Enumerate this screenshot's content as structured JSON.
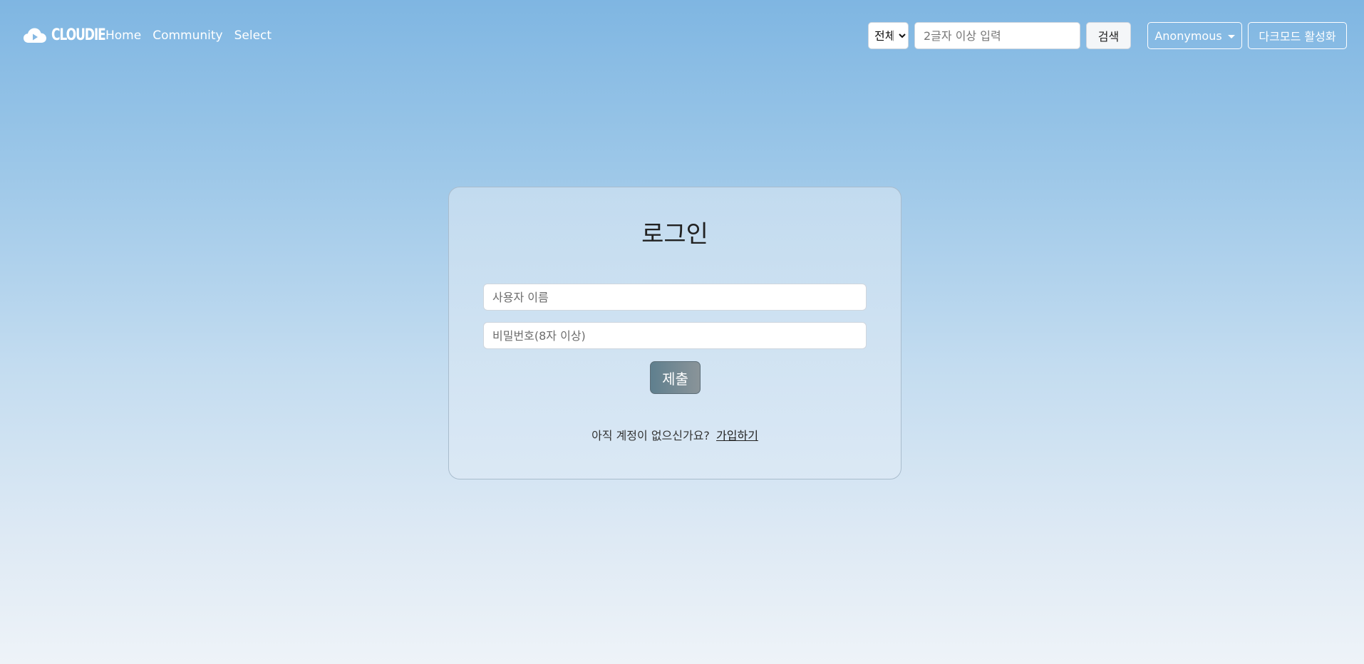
{
  "navbar": {
    "brand": "CLOUDIE",
    "links": [
      "Home",
      "Community",
      "Select"
    ],
    "search": {
      "scope_selected": "전체",
      "placeholder": "2글자 이상 입력",
      "button_label": "검색"
    },
    "user_label": "Anonymous",
    "dark_mode_label": "다크모드 활성화"
  },
  "login": {
    "title": "로그인",
    "username_placeholder": "사용자 이름",
    "password_placeholder": "비밀번호(8자 이상)",
    "submit_label": "제출",
    "no_account_text": "아직 계정이 없으신가요?",
    "signup_link": "가입하기"
  },
  "colors": {
    "accent_button": "#6b8591",
    "navbar_text": "#ffffff"
  },
  "icons": {
    "brand": "cloud-play-icon",
    "user_menu": "caret-down-icon"
  }
}
